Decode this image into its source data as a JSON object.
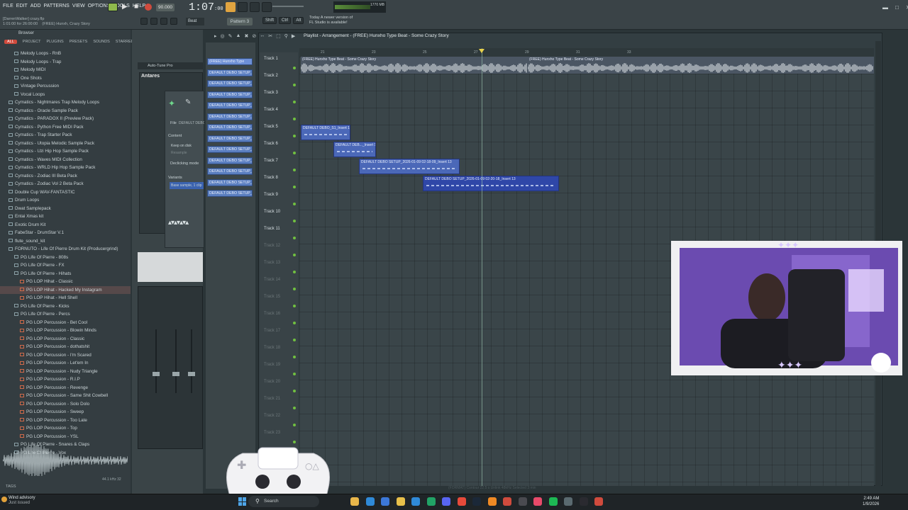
{
  "menu": [
    "FILE",
    "EDIT",
    "ADD",
    "PATTERNS",
    "VIEW",
    "OPTIONS",
    "TOOLS",
    "HELP"
  ],
  "hint": {
    "line1": "[DarrenWalker] crazy.flp",
    "line2": "1:01:00 for 26:00:00",
    "project": "(FREE) Hunxh, Crazy Story"
  },
  "transport": {
    "tempo": "90.000",
    "time": "1:07",
    "time_small": ":00",
    "pattern": "Pattern 3",
    "mode": "Beat"
  },
  "notice": {
    "line1": "Today  A newer version of",
    "line2": "FL Studio is available!"
  },
  "browser": {
    "title": "Browser",
    "tabs": [
      "ALL",
      "PROJECT",
      "PLUGINS",
      "PRESETS",
      "SOUNDS",
      "STARRED"
    ],
    "items": [
      {
        "label": "Melody Loops - RnB",
        "indent": 2,
        "type": "folder"
      },
      {
        "label": "Melody Loops - Trap",
        "indent": 2,
        "type": "folder"
      },
      {
        "label": "Melody MIDI",
        "indent": 2,
        "type": "folder"
      },
      {
        "label": "One Shots",
        "indent": 2,
        "type": "folder"
      },
      {
        "label": "Vintage Percussion",
        "indent": 2,
        "type": "folder"
      },
      {
        "label": "Vocal Loops",
        "indent": 2,
        "type": "folder"
      },
      {
        "label": "Cymatics - Nightmares Trap Melody Loops",
        "indent": 1,
        "type": "folder"
      },
      {
        "label": "Cymatics - Oracle Sample Pack",
        "indent": 1,
        "type": "folder"
      },
      {
        "label": "Cymatics - PARADOX II (Preview Pack)",
        "indent": 1,
        "type": "folder"
      },
      {
        "label": "Cymatics - Python Free MIDI Pack",
        "indent": 1,
        "type": "folder"
      },
      {
        "label": "Cymatics - Trap Starter Pack",
        "indent": 1,
        "type": "folder"
      },
      {
        "label": "Cymatics - Utopia Melodic Sample Pack",
        "indent": 1,
        "type": "folder"
      },
      {
        "label": "Cymatics - Uzi Hip Hop Sample Pack",
        "indent": 1,
        "type": "folder"
      },
      {
        "label": "Cymatics - Waves MIDI Collection",
        "indent": 1,
        "type": "folder"
      },
      {
        "label": "Cymatics - WRLD Hip Hop Sample Pack",
        "indent": 1,
        "type": "folder"
      },
      {
        "label": "Cymatics - Zodiac III Beta Pack",
        "indent": 1,
        "type": "folder"
      },
      {
        "label": "Cymatics - Zodiac Vol 2 Beta Pack",
        "indent": 1,
        "type": "folder"
      },
      {
        "label": "Double Cup WAV-FANTASTIC",
        "indent": 1,
        "type": "folder"
      },
      {
        "label": "Drum Loops",
        "indent": 1,
        "type": "folder"
      },
      {
        "label": "Dwat Samplepack",
        "indent": 1,
        "type": "folder"
      },
      {
        "label": "Entai Xmas kit",
        "indent": 1,
        "type": "folder"
      },
      {
        "label": "Exotic Drum Kit",
        "indent": 1,
        "type": "folder"
      },
      {
        "label": "FabeStar - DrumStar V.1",
        "indent": 1,
        "type": "folder"
      },
      {
        "label": "flute_sound_kit",
        "indent": 1,
        "type": "folder"
      },
      {
        "label": "FORNUTO - Life Of Pierre Drum Kit (Producergrind)",
        "indent": 1,
        "type": "open"
      },
      {
        "label": "PG Life Of Pierre - 808s",
        "indent": 2,
        "type": "folder"
      },
      {
        "label": "PG Life Of Pierre - FX",
        "indent": 2,
        "type": "folder"
      },
      {
        "label": "PG Life Of Pierre - Hihats",
        "indent": 2,
        "type": "open"
      },
      {
        "label": "PG LOP Hihat - Classic",
        "indent": 3,
        "type": "file"
      },
      {
        "label": "PG LOP Hihat - Hacked My Instagram",
        "indent": 3,
        "type": "file",
        "selected": true
      },
      {
        "label": "PG LOP Hihat - Hell Shell",
        "indent": 3,
        "type": "file"
      },
      {
        "label": "PG Life Of Pierre - Kicks",
        "indent": 2,
        "type": "folder"
      },
      {
        "label": "PG Life Of Pierre - Percs",
        "indent": 2,
        "type": "open"
      },
      {
        "label": "PG LOP Percussion - Bet Cool",
        "indent": 3,
        "type": "file"
      },
      {
        "label": "PG LOP Percussion - Blowin Minds",
        "indent": 3,
        "type": "file"
      },
      {
        "label": "PG LOP Percussion - Classic",
        "indent": 3,
        "type": "file"
      },
      {
        "label": "PG LOP Percussion - dothatshit",
        "indent": 3,
        "type": "file"
      },
      {
        "label": "PG LOP Percussion - I'm Scared",
        "indent": 3,
        "type": "file"
      },
      {
        "label": "PG LOP Percussion - Let'em In",
        "indent": 3,
        "type": "file"
      },
      {
        "label": "PG LOP Percussion - Nudy Triangle",
        "indent": 3,
        "type": "file"
      },
      {
        "label": "PG LOP Percussion - R.I.P",
        "indent": 3,
        "type": "file"
      },
      {
        "label": "PG LOP Percussion - Revenge",
        "indent": 3,
        "type": "file"
      },
      {
        "label": "PG LOP Percussion - Same Shit Cowbell",
        "indent": 3,
        "type": "file"
      },
      {
        "label": "PG LOP Percussion - Solo Dolo",
        "indent": 3,
        "type": "file"
      },
      {
        "label": "PG LOP Percussion - Sweep",
        "indent": 3,
        "type": "file"
      },
      {
        "label": "PG LOP Percussion - Too Late",
        "indent": 3,
        "type": "file"
      },
      {
        "label": "PG LOP Percussion - Top",
        "indent": 3,
        "type": "file"
      },
      {
        "label": "PG LOP Percussion - YSL",
        "indent": 3,
        "type": "file"
      },
      {
        "label": "PG Life Of Pierre - Snares & Claps",
        "indent": 2,
        "type": "folder"
      },
      {
        "label": "PG Life Of Pierre - Vox",
        "indent": 2,
        "type": "folder"
      }
    ],
    "tags_label": "TAGS",
    "sample_info": "44.1 kHz 32"
  },
  "plugin_panel": {
    "title": "Auto-Tune Pro",
    "subtitle": "Antares",
    "file_label": "File",
    "file_value": "DEFAULT DEBO SE",
    "content_label": "Content",
    "keep_on_disk": "Keep on disk",
    "resample": "Resample",
    "declicking": "Declicking mode",
    "variants": "Variants",
    "variant_value": "Base sample, 1 clip"
  },
  "channels": [
    "(FREE) Hunxho Type",
    "DEFAULT DEBO SETUP_202",
    "DEFAULT DEBO SETUP_202",
    "DEFAULT DEBO SETUP_202",
    "DEFAULT DEBO SETUP_202",
    "DEFAULT DEBO SETUP_202",
    "DEFAULT DEBO SETUP_202",
    "DEFAULT DEBO SETUP_202",
    "DEFAULT DEBO SETUP_202",
    "DEFAULT DEBO SETUP_202",
    "DEFAULT DEBO SETUP_202",
    "DEFAULT DEBO SETUP_202",
    "DEFAULT DEBO SETUP_202"
  ],
  "playlist": {
    "title": "Playlist - Arrangement - (FREE) Hunxho Type Beat - Some Crazy Story",
    "ruler": [
      "21",
      "23",
      "25",
      "27",
      "29",
      "31",
      "33"
    ],
    "tracks": [
      "Track 1",
      "Track 2",
      "Track 3",
      "Track 4",
      "Track 5",
      "Track 6",
      "Track 7",
      "Track 8",
      "Track 9",
      "Track 10",
      "Track 11",
      "Track 12",
      "Track 13",
      "Track 14",
      "Track 15",
      "Track 16",
      "Track 17",
      "Track 18",
      "Track 19",
      "Track 20",
      "Track 21",
      "Track 22",
      "Track 23"
    ],
    "audio_clips": [
      {
        "label": "(FREE) Hunxho Type Beat - Some Crazy Story"
      },
      {
        "label": "(FREE) Hunxho Type Beat - Some Crazy Story"
      }
    ],
    "clips": [
      {
        "label": "DEFAULT DEBO_S1_Insert 13"
      },
      {
        "label": "DEFAULT DEB..._Insert 13"
      },
      {
        "label": "DEFAULT DEBO SETUP_2026-01-09 02-18-09_Insert 13"
      },
      {
        "label": "DEFAULT DEBO SETUP_2026-01-09 02-20-18_Insert 13"
      }
    ],
    "status": "(FORMAT)  Contour  22.5 s  Unlink  48kHz  Selected  3 min"
  },
  "taskbar": {
    "weather_title": "Wind advisory",
    "weather_sub": "Just issued",
    "search": "Search",
    "time": "2:49 AM",
    "date": "1/9/2026"
  },
  "colors": {
    "clip": "#4b68b8",
    "accent": "#d04b3d",
    "led": "#70c040"
  }
}
